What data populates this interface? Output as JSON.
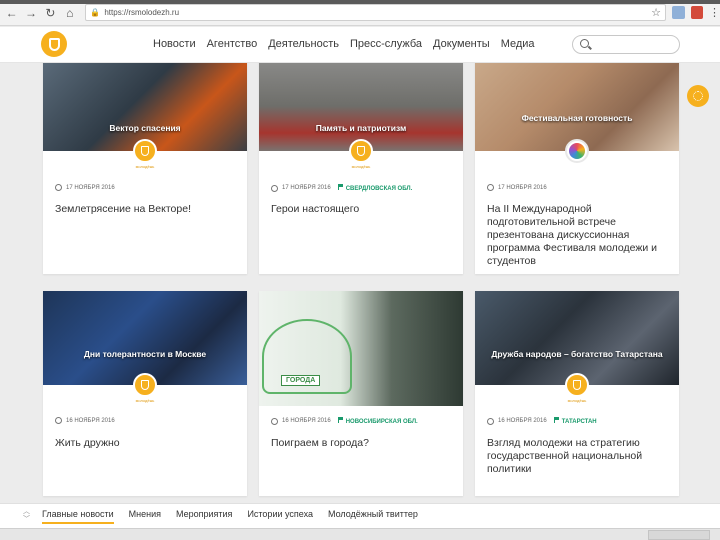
{
  "browser": {
    "url": "https://rsmolodezh.ru",
    "back": "←",
    "forward": "→",
    "reload": "↻",
    "home": "⌂",
    "star": "☆",
    "menu": "⋮"
  },
  "header": {
    "nav": [
      "Новости",
      "Агентство",
      "Деятельность",
      "Пресс-служба",
      "Документы",
      "Медиа"
    ],
    "logo_icon": "shield-icon",
    "search_icon": "search-icon",
    "accent": "#f6b01e"
  },
  "cards": [
    {
      "image_title": "Вектор спасения",
      "date": "17 НОЯБРЯ 2016",
      "region": "",
      "title": "Землетрясение на Векторе!"
    },
    {
      "image_title": "Память и патриотизм",
      "date": "17 НОЯБРЯ 2016",
      "region": "СВЕРДЛОВСКАЯ ОБЛ.",
      "title": "Герои настоящего"
    },
    {
      "image_title": "Фестивальная готовность",
      "date": "17 НОЯБРЯ 2016",
      "region": "",
      "title": "На II Международной подготовительной встрече презентована дискуссионная программа Фестиваля молодежи и студентов"
    },
    {
      "image_title": "Дни толерантности в Москве",
      "date": "16 НОЯБРЯ 2016",
      "region": "",
      "title": "Жить дружно"
    },
    {
      "image_title": "",
      "image_banner": "ГОРОДА",
      "date": "16 НОЯБРЯ 2016",
      "region": "НОВОСИБИРСКАЯ ОБЛ.",
      "title": "Поиграем в города?"
    },
    {
      "image_title": "Дружба народов – богатство Татарстана",
      "date": "16 НОЯБРЯ 2016",
      "region": "ТАТАРСТАН",
      "title": "Взгляд молодежи на стратегию государственной национальной политики"
    }
  ],
  "badge_label": "молодёжь",
  "bottom_tabs": [
    "Главные новости",
    "Мнения",
    "Мероприятия",
    "Истории успеха",
    "Молодёжный твиттер"
  ],
  "bottom_active_tab": "Главные новости"
}
